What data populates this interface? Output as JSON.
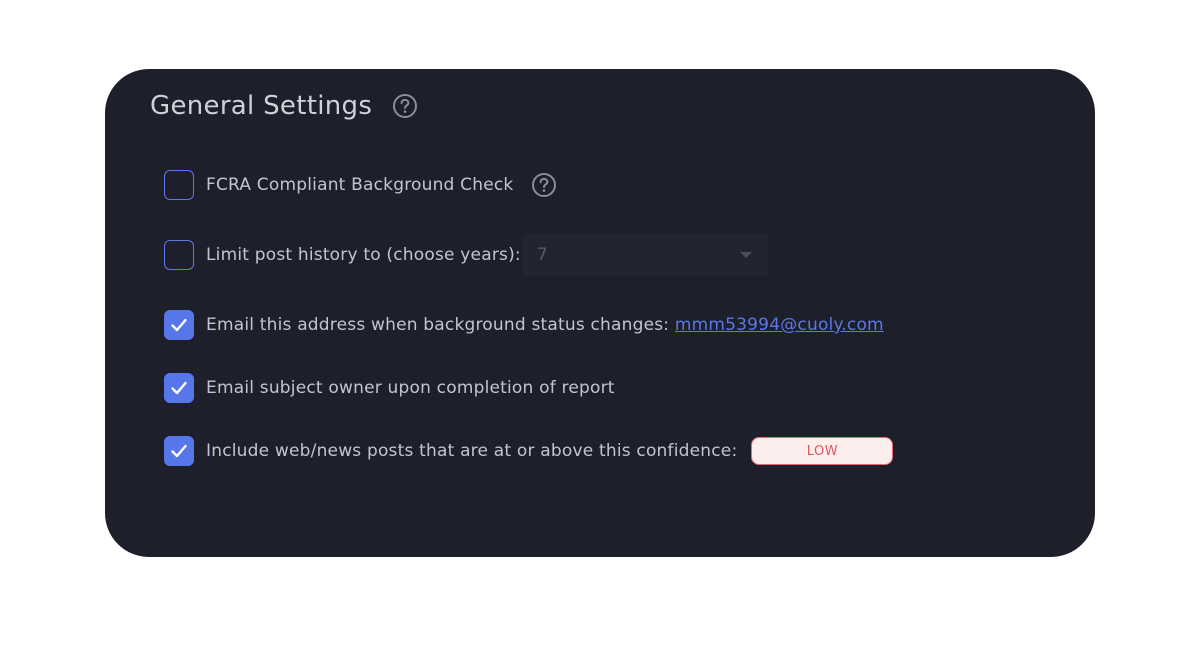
{
  "title": "General Settings",
  "icons": {
    "help": "question-circle-icon",
    "check": "checkmark-icon",
    "caret": "caret-down-icon"
  },
  "colors": {
    "panel_bg": "#1d1f2b",
    "accent": "#5676ea",
    "badge_text": "#e0575f",
    "badge_bg": "#fdeeee"
  },
  "settings": [
    {
      "label": "FCRA Compliant Background Check",
      "checked": false
    },
    {
      "label": "Limit post history to (choose years):",
      "checked": false,
      "select_value": "7"
    },
    {
      "label": "Email this address when background status changes:",
      "checked": true,
      "link": "mmm53994@cuoly.com"
    },
    {
      "label": "Email subject owner upon completion of report",
      "checked": true
    },
    {
      "label": "Include web/news posts that are at or above this confidence:",
      "checked": true,
      "badge": "LOW"
    }
  ]
}
